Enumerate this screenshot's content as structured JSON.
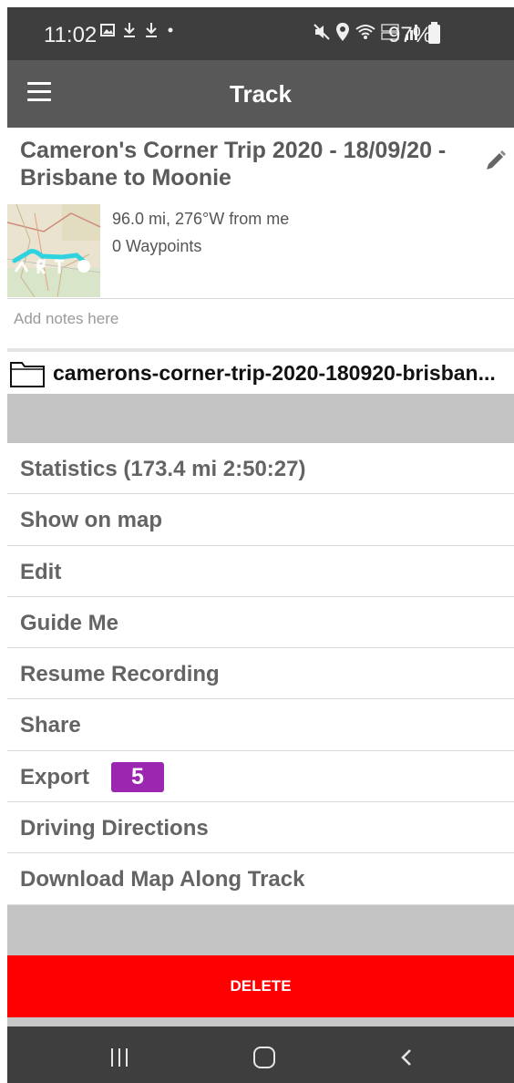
{
  "status_bar": {
    "time": "11:02",
    "battery_pct": "97%",
    "left_icons": [
      "gallery-icon",
      "download-icon",
      "download-icon",
      "dot-icon"
    ],
    "right_icons": [
      "mute-icon",
      "location-icon",
      "wifi-icon",
      "volte-icon",
      "signal-icon",
      "battery-icon"
    ]
  },
  "app_bar": {
    "title": "Track",
    "menu_icon": "hamburger-menu-icon"
  },
  "track": {
    "title": "Cameron's Corner Trip 2020 - 18/09/20 - Brisbane to Moonie",
    "distance_bearing": "96.0 mi, 276°W from me",
    "waypoints": "0 Waypoints",
    "notes_placeholder": "Add notes here",
    "folder_name": "camerons-corner-trip-2020-180920-brisban..."
  },
  "menu": {
    "items": [
      {
        "label": "Statistics (173.4 mi 2:50:27)"
      },
      {
        "label": "Show on map"
      },
      {
        "label": "Edit"
      },
      {
        "label": "Guide Me"
      },
      {
        "label": "Resume Recording"
      },
      {
        "label": "Share"
      },
      {
        "label": "Export",
        "badge": "5"
      },
      {
        "label": "Driving Directions"
      },
      {
        "label": "Download Map Along Track"
      }
    ]
  },
  "delete_label": "DELETE",
  "colors": {
    "status_bar": "#3e3e3e",
    "app_bar": "#585858",
    "delete": "#ff0000",
    "badge": "#9b27b0",
    "band": "#c3c3c4"
  }
}
